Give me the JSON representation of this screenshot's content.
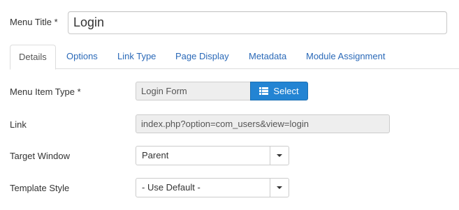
{
  "menu_title": {
    "label": "Menu Title *",
    "value": "Login"
  },
  "tabs": [
    {
      "label": "Details",
      "active": true
    },
    {
      "label": "Options",
      "active": false
    },
    {
      "label": "Link Type",
      "active": false
    },
    {
      "label": "Page Display",
      "active": false
    },
    {
      "label": "Metadata",
      "active": false
    },
    {
      "label": "Module Assignment",
      "active": false
    }
  ],
  "fields": {
    "menu_item_type": {
      "label": "Menu Item Type *",
      "value": "Login Form",
      "button_label": "Select",
      "button_icon": "list-icon"
    },
    "link": {
      "label": "Link",
      "value": "index.php?option=com_users&view=login"
    },
    "target_window": {
      "label": "Target Window",
      "selected": "Parent"
    },
    "template_style": {
      "label": "Template Style",
      "selected": "- Use Default -"
    }
  },
  "colors": {
    "accent": "#2384d3",
    "link": "#2a69b8",
    "readonly_bg": "#eeeeee",
    "border": "#cccccc"
  }
}
